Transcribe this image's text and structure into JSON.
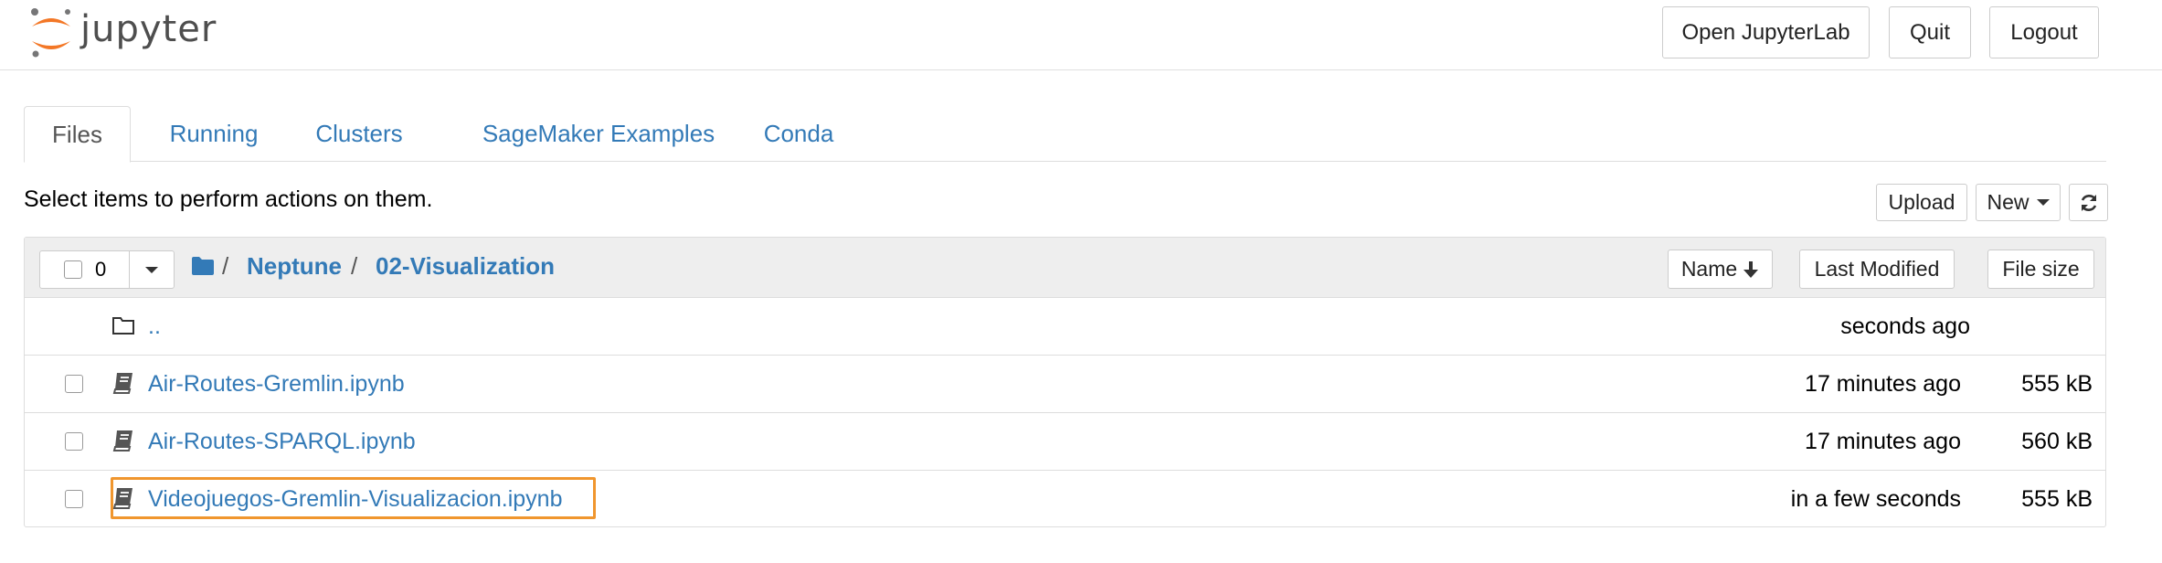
{
  "header": {
    "logo_text": "jupyter",
    "buttons": {
      "open_jupyterlab": "Open JupyterLab",
      "quit": "Quit",
      "logout": "Logout"
    }
  },
  "tabs": [
    {
      "label": "Files",
      "active": true
    },
    {
      "label": "Running",
      "active": false
    },
    {
      "label": "Clusters",
      "active": false
    },
    {
      "label": "SageMaker Examples",
      "active": false
    },
    {
      "label": "Conda",
      "active": false
    }
  ],
  "toolbar": {
    "hint": "Select items to perform actions on them.",
    "upload_label": "Upload",
    "new_label": "New"
  },
  "list_header": {
    "selected_count": "0",
    "breadcrumb": [
      "Neptune",
      "02-Visualization"
    ],
    "separator": "/",
    "columns": {
      "name": "Name",
      "last_modified": "Last Modified",
      "file_size": "File size"
    }
  },
  "rows": [
    {
      "type": "folder",
      "name": "..",
      "modified": "seconds ago",
      "size": ""
    },
    {
      "type": "notebook",
      "name": "Air-Routes-Gremlin.ipynb",
      "modified": "17 minutes ago",
      "size": "555 kB"
    },
    {
      "type": "notebook",
      "name": "Air-Routes-SPARQL.ipynb",
      "modified": "17 minutes ago",
      "size": "560 kB"
    },
    {
      "type": "notebook",
      "name": "Videojuegos-Gremlin-Visualizacion.ipynb",
      "modified": "in a few seconds",
      "size": "555 kB",
      "highlighted": true
    }
  ],
  "colors": {
    "link": "#337ab7",
    "logo_orange": "#f37726",
    "highlight": "#f0962e"
  }
}
